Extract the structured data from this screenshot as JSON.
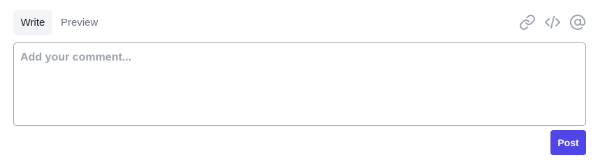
{
  "tabs": [
    {
      "label": "Write",
      "active": true
    },
    {
      "label": "Preview",
      "active": false
    }
  ],
  "toolbar": {
    "icons": [
      "link-icon",
      "code-icon",
      "at-sign-icon"
    ],
    "icon_color": "#9ca3af"
  },
  "comment": {
    "placeholder": "Add your comment...",
    "value": ""
  },
  "actions": {
    "post_label": "Post",
    "post_color": "#4f46e5"
  }
}
